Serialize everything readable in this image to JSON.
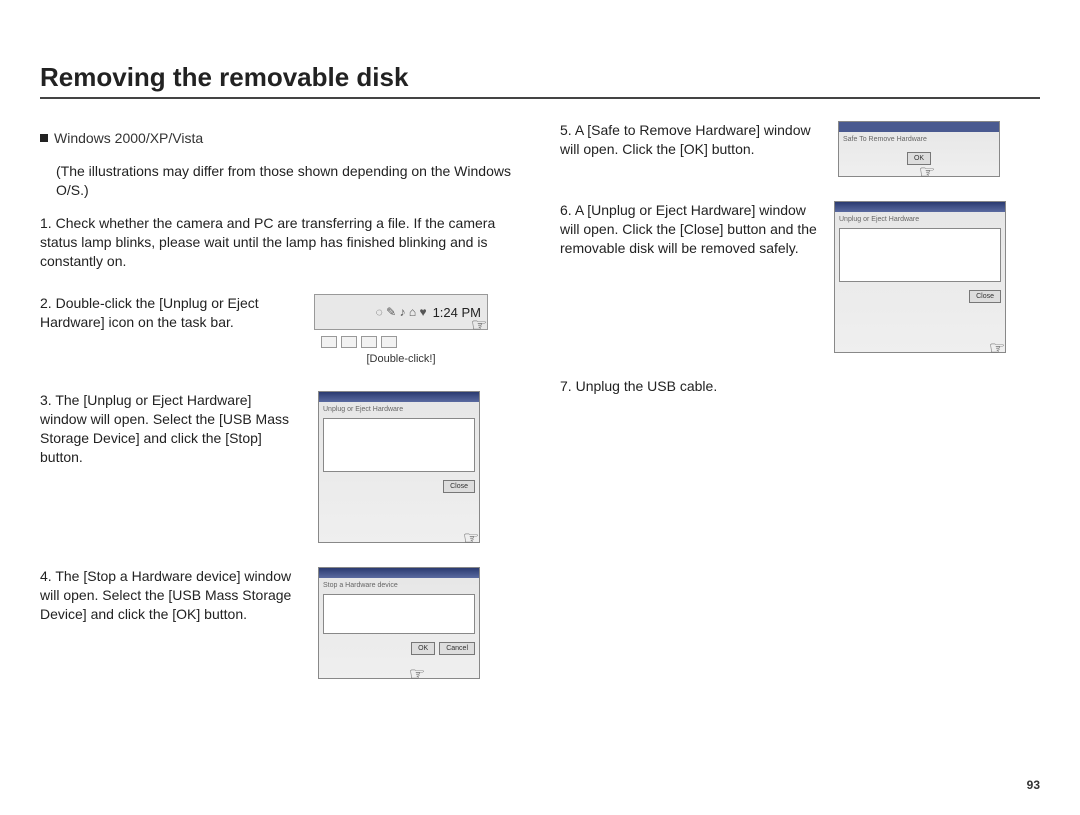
{
  "title": "Removing the removable disk",
  "page_number": "93",
  "left": {
    "platform_label": "Windows 2000/XP/Vista",
    "disclaimer": "(The illustrations may differ from those shown depending on the Windows O/S.)",
    "step1_num": "1.",
    "step1": "Check whether the camera and PC are transferring a file. If the camera status lamp blinks, please wait until the lamp has finished blinking and is constantly on.",
    "step2_num": "2.",
    "step2": "Double-click the [Unplug or Eject Hardware] icon on the task bar.",
    "step2_clock": "1:24 PM",
    "step2_caption": "[Double-click!]",
    "step3_num": "3.",
    "step3": "The [Unplug or Eject Hardware] window will open. Select the [USB Mass Storage Device] and click the [Stop] button.",
    "step3_wintitle": "Unplug or Eject Hardware",
    "step3_btn": "Close",
    "step4_num": "4.",
    "step4": "The [Stop a Hardware device] window will open. Select the [USB Mass Storage Device] and click the [OK] button.",
    "step4_wintitle": "Stop a Hardware device",
    "step4_btn_ok": "OK",
    "step4_btn_cancel": "Cancel"
  },
  "right": {
    "step5_num": "5.",
    "step5": "A [Safe to Remove Hardware] window will open. Click the [OK] button.",
    "step5_wintitle": "Safe To Remove Hardware",
    "step5_btn": "OK",
    "step6_num": "6.",
    "step6": "A [Unplug or Eject Hardware] window will open. Click the [Close] button and the removable disk will be removed safely.",
    "step6_wintitle": "Unplug or Eject Hardware",
    "step6_btn": "Close",
    "step7_num": "7.",
    "step7": "Unplug the USB cable."
  }
}
